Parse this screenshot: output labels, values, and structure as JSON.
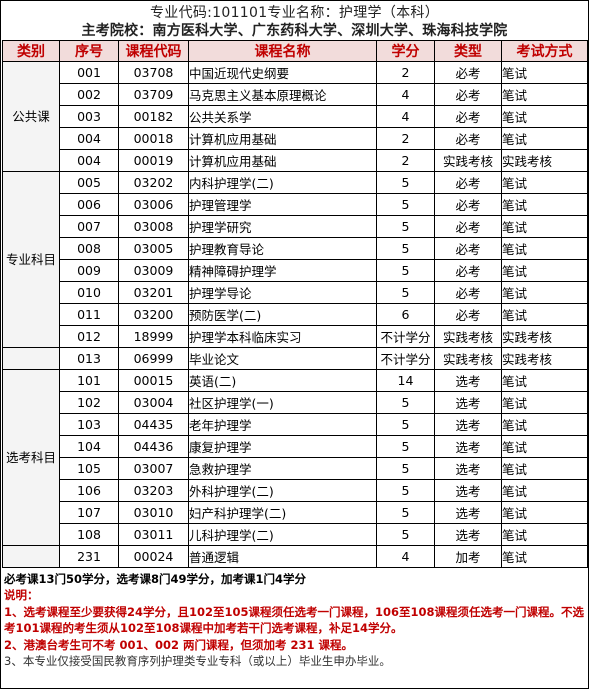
{
  "header": {
    "line1": "专业代码:101101专业名称：护理学（本科）",
    "line2": "主考院校：南方医科大学、广东药科大学、深圳大学、珠海科技学院"
  },
  "columns": [
    "类别",
    "序号",
    "课程代码",
    "课程名称",
    "学分",
    "类型",
    "考试方式"
  ],
  "groups": [
    {
      "category": "公共课",
      "rows": [
        {
          "seq": "001",
          "code": "03708",
          "name": "中国近现代史纲要",
          "credit": "2",
          "type": "必考",
          "exam": "笔试"
        },
        {
          "seq": "002",
          "code": "03709",
          "name": "马克思主义基本原理概论",
          "credit": "4",
          "type": "必考",
          "exam": "笔试"
        },
        {
          "seq": "003",
          "code": "00182",
          "name": "公共关系学",
          "credit": "4",
          "type": "必考",
          "exam": "笔试"
        },
        {
          "seq": "004",
          "code": "00018",
          "name": "计算机应用基础",
          "credit": "2",
          "type": "必考",
          "exam": "笔试"
        },
        {
          "seq": "004",
          "code": "00019",
          "name": "计算机应用基础",
          "credit": "2",
          "type": "实践考核",
          "exam": "实践考核"
        }
      ]
    },
    {
      "category": "专业科目",
      "rows": [
        {
          "seq": "005",
          "code": "03202",
          "name": "内科护理学(二)",
          "credit": "5",
          "type": "必考",
          "exam": "笔试"
        },
        {
          "seq": "006",
          "code": "03006",
          "name": "护理管理学",
          "credit": "5",
          "type": "必考",
          "exam": "笔试"
        },
        {
          "seq": "007",
          "code": "03008",
          "name": "护理学研究",
          "credit": "5",
          "type": "必考",
          "exam": "笔试"
        },
        {
          "seq": "008",
          "code": "03005",
          "name": "护理教育导论",
          "credit": "5",
          "type": "必考",
          "exam": "笔试"
        },
        {
          "seq": "009",
          "code": "03009",
          "name": "精神障碍护理学",
          "credit": "5",
          "type": "必考",
          "exam": "笔试"
        },
        {
          "seq": "010",
          "code": "03201",
          "name": "护理学导论",
          "credit": "5",
          "type": "必考",
          "exam": "笔试"
        },
        {
          "seq": "011",
          "code": "03200",
          "name": "预防医学(二)",
          "credit": "6",
          "type": "必考",
          "exam": "笔试"
        },
        {
          "seq": "012",
          "code": "18999",
          "name": "护理学本科临床实习",
          "credit": "不计学分",
          "type": "实践考核",
          "exam": "实践考核"
        }
      ]
    },
    {
      "category": "",
      "rows": [
        {
          "seq": "013",
          "code": "06999",
          "name": "毕业论文",
          "credit": "不计学分",
          "type": "实践考核",
          "exam": "实践考核"
        }
      ]
    },
    {
      "category": "选考科目",
      "rows": [
        {
          "seq": "101",
          "code": "00015",
          "name": "英语(二)",
          "credit": "14",
          "type": "选考",
          "exam": "笔试"
        },
        {
          "seq": "102",
          "code": "03004",
          "name": "社区护理学(一)",
          "credit": "5",
          "type": "选考",
          "exam": "笔试"
        },
        {
          "seq": "103",
          "code": "04435",
          "name": "老年护理学",
          "credit": "5",
          "type": "选考",
          "exam": "笔试"
        },
        {
          "seq": "104",
          "code": "04436",
          "name": "康复护理学",
          "credit": "5",
          "type": "选考",
          "exam": "笔试"
        },
        {
          "seq": "105",
          "code": "03007",
          "name": "急救护理学",
          "credit": "5",
          "type": "选考",
          "exam": "笔试"
        },
        {
          "seq": "106",
          "code": "03203",
          "name": "外科护理学(二)",
          "credit": "5",
          "type": "选考",
          "exam": "笔试"
        },
        {
          "seq": "107",
          "code": "03010",
          "name": "妇产科护理学(二)",
          "credit": "5",
          "type": "选考",
          "exam": "笔试"
        },
        {
          "seq": "108",
          "code": "03011",
          "name": "儿科护理学(二)",
          "credit": "5",
          "type": "选考",
          "exam": "笔试"
        }
      ]
    },
    {
      "category": "",
      "rows": [
        {
          "seq": "231",
          "code": "00024",
          "name": "普通逻辑",
          "credit": "4",
          "type": "加考",
          "exam": "笔试"
        }
      ]
    }
  ],
  "notes": {
    "credits": "必考课13门50学分，选考课8门49学分，加考课1门4学分",
    "title": "说明：",
    "n1": "1、选考课程至少要获得24学分，且102至105课程须任选考一门课程，106至108课程须任选考一门课程。不选考101课程的考生须从102至108课程中加考若干门选考课程，补足14学分。",
    "n2": "2、港澳台考生可不考 001、002 两门课程，但须加考 231 课程。",
    "n3": "3、本专业仅接受国民教育序列护理类专业专科（或以上）毕业生申办毕业。"
  }
}
